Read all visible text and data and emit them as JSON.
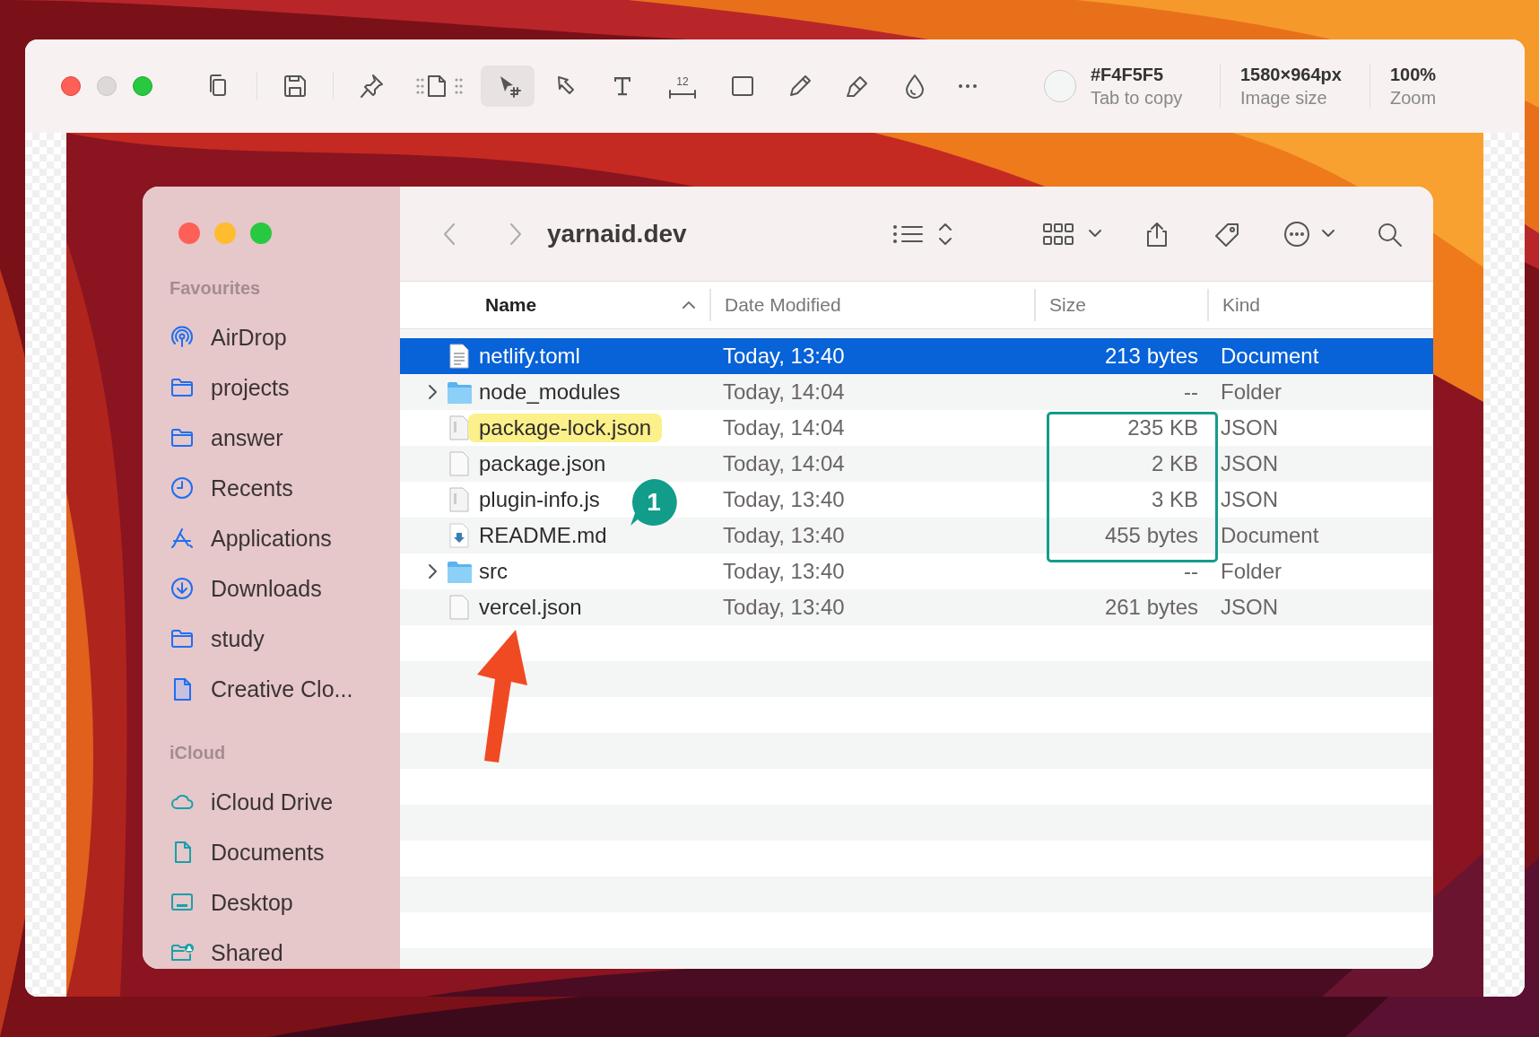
{
  "editor": {
    "tool_groups": [
      [
        {
          "kind": "copy",
          "selected": false
        }
      ],
      [
        {
          "kind": "save",
          "selected": false
        }
      ],
      [
        {
          "kind": "pin",
          "selected": false
        },
        {
          "kind": "page-dots",
          "selected": false
        },
        {
          "kind": "select",
          "selected": true
        },
        {
          "kind": "pointer",
          "selected": false
        },
        {
          "kind": "text",
          "selected": false
        },
        {
          "kind": "measure",
          "label": "12",
          "selected": false
        },
        {
          "kind": "rect",
          "selected": false
        },
        {
          "kind": "pencil",
          "selected": false
        },
        {
          "kind": "marker",
          "selected": false
        },
        {
          "kind": "drop",
          "selected": false
        },
        {
          "kind": "more",
          "selected": false
        }
      ]
    ],
    "color": {
      "value": "#F4F5F5",
      "label": "Tab to copy"
    },
    "stats": [
      {
        "value": "1580×964px",
        "label": "Image size"
      },
      {
        "value": "100%",
        "label": "Zoom"
      }
    ]
  },
  "finder": {
    "title": "yarnaid.dev",
    "toolbar": [
      {
        "kind": "back"
      },
      {
        "kind": "forward"
      },
      {
        "kind": "title"
      },
      {
        "kind": "list-view"
      },
      {
        "kind": "sort"
      },
      {
        "kind": "grid"
      },
      {
        "kind": "chevron"
      },
      {
        "kind": "share"
      },
      {
        "kind": "tag"
      },
      {
        "kind": "more"
      },
      {
        "kind": "chevron"
      },
      {
        "kind": "search"
      }
    ],
    "sidebar": [
      {
        "heading": "Favourites",
        "items": [
          {
            "label": "AirDrop",
            "kind": "airdrop"
          },
          {
            "label": "projects",
            "kind": "folder"
          },
          {
            "label": "answer",
            "kind": "folder"
          },
          {
            "label": "Recents",
            "kind": "clock"
          },
          {
            "label": "Applications",
            "kind": "apps"
          },
          {
            "label": "Downloads",
            "kind": "download"
          },
          {
            "label": "study",
            "kind": "folder"
          },
          {
            "label": "Creative Clo...",
            "kind": "doc-filled"
          }
        ]
      },
      {
        "heading": "iCloud",
        "items": [
          {
            "label": "iCloud Drive",
            "kind": "cloud"
          },
          {
            "label": "Documents",
            "kind": "document"
          },
          {
            "label": "Desktop",
            "kind": "desktop"
          },
          {
            "label": "Shared",
            "kind": "shared"
          }
        ]
      }
    ],
    "columns": [
      {
        "label": "Name",
        "sorted": true
      },
      {
        "label": "Date Modified",
        "sorted": false
      },
      {
        "label": "Size",
        "sorted": false
      },
      {
        "label": "Kind",
        "sorted": false
      }
    ],
    "rows": [
      {
        "name": "netlify.toml",
        "kind": "text-doc",
        "date": "Today, 13:40",
        "size": "213 bytes",
        "type": "Document",
        "selected": true,
        "highlighted": false,
        "boxed": false
      },
      {
        "name": "node_modules",
        "kind": "folder",
        "date": "Today, 14:04",
        "size": "--",
        "type": "Folder",
        "selected": false,
        "highlighted": false,
        "boxed": false
      },
      {
        "name": "package-lock.json",
        "kind": "json",
        "date": "Today, 14:04",
        "size": "235 KB",
        "type": "JSON",
        "selected": false,
        "highlighted": true,
        "boxed": true
      },
      {
        "name": "package.json",
        "kind": "blank",
        "date": "Today, 14:04",
        "size": "2 KB",
        "type": "JSON",
        "selected": false,
        "highlighted": false,
        "boxed": true
      },
      {
        "name": "plugin-info.js",
        "kind": "json",
        "date": "Today, 13:40",
        "size": "3 KB",
        "type": "JSON",
        "selected": false,
        "highlighted": false,
        "boxed": true
      },
      {
        "name": "README.md",
        "kind": "download-doc",
        "date": "Today, 13:40",
        "size": "455 bytes",
        "type": "Document",
        "selected": false,
        "highlighted": false,
        "boxed": true
      },
      {
        "name": "src",
        "kind": "folder",
        "date": "Today, 13:40",
        "size": "--",
        "type": "Folder",
        "selected": false,
        "highlighted": false,
        "boxed": false
      },
      {
        "name": "vercel.json",
        "kind": "blank",
        "date": "Today, 13:40",
        "size": "261 bytes",
        "type": "JSON",
        "selected": false,
        "highlighted": false,
        "boxed": false
      }
    ]
  },
  "annotations": [
    {
      "kind": "callout",
      "text": "1"
    },
    {
      "kind": "arrow"
    }
  ]
}
